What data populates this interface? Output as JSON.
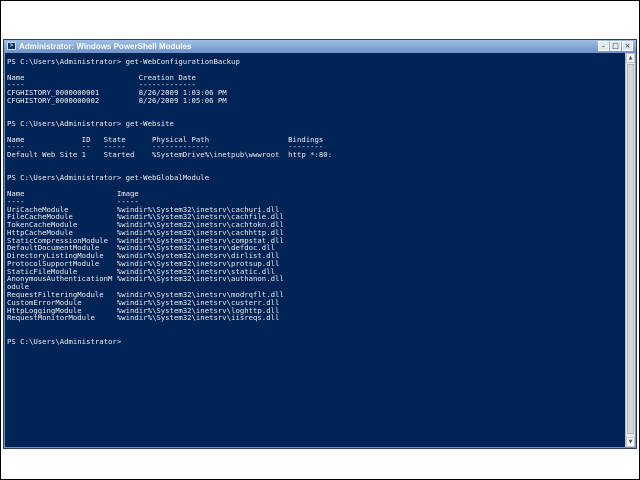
{
  "window": {
    "title": "Administrator: Windows PowerShell Modules",
    "minimize_glyph": "–",
    "maximize_glyph": "□",
    "close_glyph": "×"
  },
  "console": {
    "colors": {
      "background": "#012456",
      "text": "#eeeeee"
    },
    "lines": [
      "PS C:\\Users\\Administrator> get-WebConfigurationBackup",
      "",
      "Name                          Creation Date",
      "----                          -------------",
      "CFGHISTORY_0000000001         8/26/2009 1:03:06 PM",
      "CFGHISTORY_0000000002         8/26/2009 1:05:06 PM",
      "",
      "",
      "PS C:\\Users\\Administrator> get-Website",
      "",
      "Name             ID   State      Physical Path                  Bindings",
      "----             --   -----      -------------                  --------",
      "Default Web Site 1    Started    %SystemDrive%\\inetpub\\wwwroot  http *:80:",
      "",
      "",
      "PS C:\\Users\\Administrator> get-WebGlobalModule",
      "",
      "Name                     Image",
      "----                     -----",
      "UriCacheModule           %windir%\\System32\\inetsrv\\cachuri.dll",
      "FileCacheModule          %windir%\\System32\\inetsrv\\cachfile.dll",
      "TokenCacheModule         %windir%\\System32\\inetsrv\\cachtokn.dll",
      "HttpCacheModule          %windir%\\System32\\inetsrv\\cachhttp.dll",
      "StaticCompressionModule  %windir%\\System32\\inetsrv\\compstat.dll",
      "DefaultDocumentModule    %windir%\\System32\\inetsrv\\defdoc.dll",
      "DirectoryListingModule   %windir%\\System32\\inetsrv\\dirlist.dll",
      "ProtocolSupportModule    %windir%\\System32\\inetsrv\\protsup.dll",
      "StaticFileModule         %windir%\\System32\\inetsrv\\static.dll",
      "AnonymousAuthenticationM %windir%\\System32\\inetsrv\\authanon.dll",
      "odule",
      "RequestFilteringModule   %windir%\\System32\\inetsrv\\modrqflt.dll",
      "CustomErrorModule        %windir%\\System32\\inetsrv\\custerr.dll",
      "HttpLoggingModule        %windir%\\System32\\inetsrv\\loghttp.dll",
      "RequestMonitorModule     %windir%\\System32\\inetsrv\\iisreqs.dll",
      "",
      "",
      "PS C:\\Users\\Administrator>"
    ]
  }
}
